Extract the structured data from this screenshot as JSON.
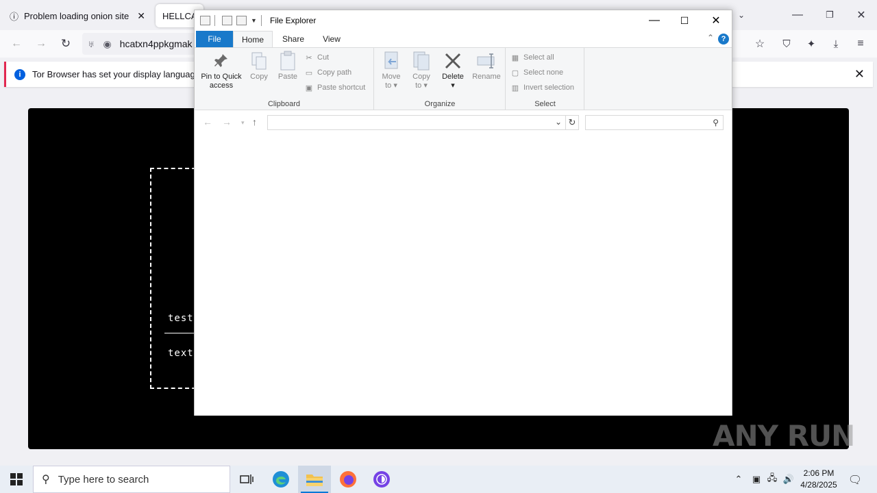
{
  "browser": {
    "tabs": [
      {
        "label": "Problem loading onion site",
        "active": false
      },
      {
        "label": "HELLCAT",
        "active": true
      }
    ],
    "url": "hcatxn4ppkgmak",
    "notification": "Tor Browser has set your display language to l"
  },
  "page": {
    "line1": "test",
    "line2": "text"
  },
  "explorer": {
    "title": "File Explorer",
    "ribbon_tabs": {
      "file": "File",
      "home": "Home",
      "share": "Share",
      "view": "View"
    },
    "help_label": "?",
    "clipboard": {
      "pin_line1": "Pin to Quick",
      "pin_line2": "access",
      "copy": "Copy",
      "paste": "Paste",
      "cut": "Cut",
      "copy_path": "Copy path",
      "paste_shortcut": "Paste shortcut",
      "group_label": "Clipboard"
    },
    "organize": {
      "move_line1": "Move",
      "move_line2": "to",
      "copy_line1": "Copy",
      "copy_line2": "to",
      "delete": "Delete",
      "rename": "Rename",
      "group_label": "Organize"
    },
    "select": {
      "select_all": "Select all",
      "select_none": "Select none",
      "invert_selection": "Invert selection",
      "group_label": "Select"
    },
    "address_value": "",
    "search_value": ""
  },
  "watermark": "ANY RUN",
  "taskbar": {
    "search_placeholder": "Type here to search",
    "time": "2:06 PM",
    "date": "4/28/2025"
  },
  "colors": {
    "accent_blue": "#1979ca",
    "tor_purple": "#7542e5",
    "notification_bar": "#e22850"
  }
}
